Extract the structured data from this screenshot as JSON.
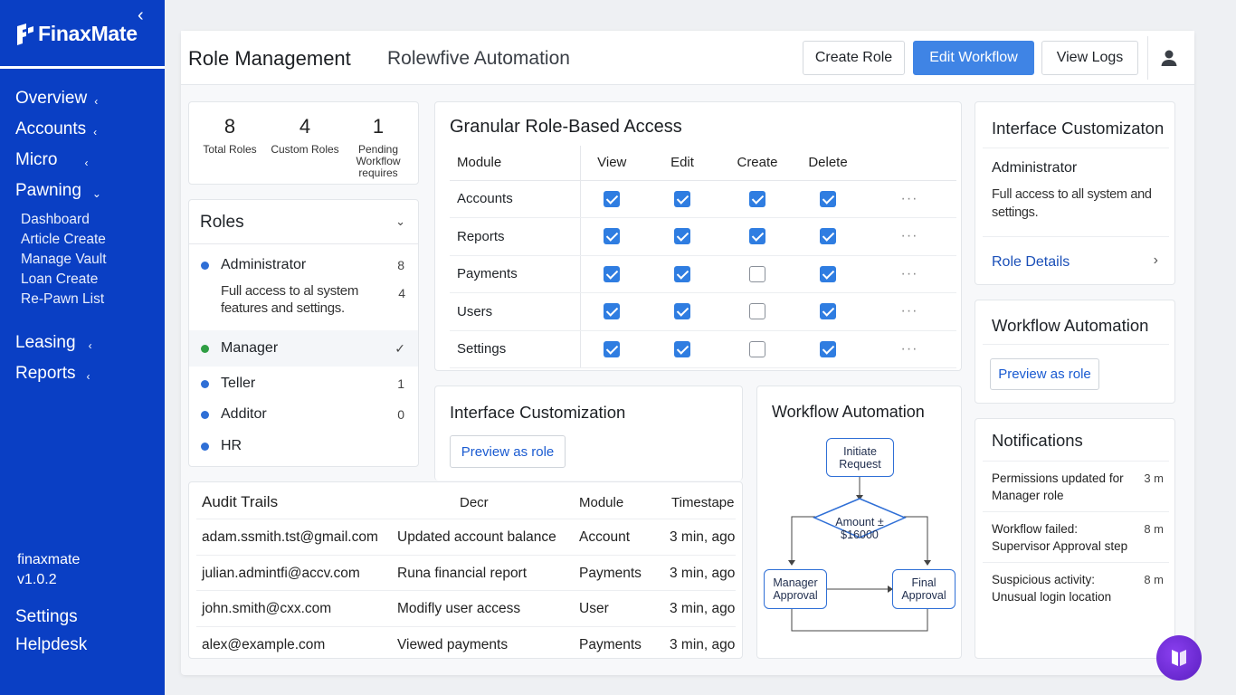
{
  "sidebar": {
    "logo": "FinaxMate",
    "nav": [
      {
        "label": "Overview"
      },
      {
        "label": "Accounts"
      },
      {
        "label": "Micro"
      },
      {
        "label": "Pawning"
      },
      {
        "label": "Leasing"
      },
      {
        "label": "Reports"
      }
    ],
    "pawning_sub": [
      "Dashboard",
      "Article Create",
      "Manage Vault",
      "Loan Create",
      "Re-Pawn List"
    ],
    "app_name": "finaxmate",
    "version": "v1.0.2",
    "settings": "Settings",
    "helpdesk": "Helpdesk"
  },
  "header": {
    "title": "Role Management",
    "subtitle": "Rolewfive Automation",
    "create_role": "Create Role",
    "edit_workflow": "Edit Workflow",
    "view_logs": "View Logs"
  },
  "stats": [
    {
      "value": "8",
      "label": "Total Roles"
    },
    {
      "value": "4",
      "label": "Custom Roles"
    },
    {
      "value": "1",
      "label_lines": [
        "Pending",
        "Workflow",
        "requires"
      ]
    }
  ],
  "roles": {
    "title": "Roles",
    "items": [
      {
        "name": "Administrator",
        "count": "8",
        "color": "#2f6fd6"
      },
      {
        "name": "Manager",
        "color": "#2f9e44"
      },
      {
        "name": "Teller",
        "count": "1",
        "color": "#2f6fd6"
      },
      {
        "name": "Additor",
        "count": "0",
        "color": "#2f6fd6"
      },
      {
        "name": "HR",
        "color": "#2f6fd6"
      }
    ],
    "admin_desc": "Full access to al system features and settings.",
    "admin_desc_count": "4"
  },
  "access": {
    "title": "Granular Role-Based Access",
    "columns": [
      "Module",
      "View",
      "Edit",
      "Create",
      "Delete"
    ],
    "rows": [
      {
        "module": "Accounts",
        "perms": [
          true,
          true,
          true,
          true
        ]
      },
      {
        "module": "Reports",
        "perms": [
          true,
          true,
          true,
          true
        ]
      },
      {
        "module": "Payments",
        "perms": [
          true,
          true,
          false,
          true
        ]
      },
      {
        "module": "Users",
        "perms": [
          true,
          true,
          false,
          true
        ]
      },
      {
        "module": "Settings",
        "perms": [
          true,
          true,
          false,
          true
        ]
      }
    ],
    "more": "···"
  },
  "interface": {
    "title": "Interface Customization",
    "preview": "Preview as role"
  },
  "workflow": {
    "title": "Workflow Automation",
    "initiate": "Initiate Request",
    "amount": "Amount ± $16000",
    "manager": "Manager Approval",
    "final": "Final Approval"
  },
  "audit": {
    "title": "Audit Trails",
    "col_desc": "Decr",
    "col_module": "Module",
    "col_time": "Timestape",
    "rows": [
      {
        "user": "adam.ssmith.tst@gmail.com",
        "desc": "Updated account balance",
        "module": "Account",
        "time": "3 min, ago"
      },
      {
        "user": "julian.admintfi@accv.com",
        "desc": "Runa financial report",
        "module": "Payments",
        "time": "3 min, ago"
      },
      {
        "user": "john.smith@cxx.com",
        "desc": "Modifly user access",
        "module": "User",
        "time": "3 min, ago"
      },
      {
        "user": "alex@example.com",
        "desc": "Viewed payments",
        "module": "Payments",
        "time": "3 min, ago"
      }
    ]
  },
  "right": {
    "ic_title": "Interface Customizaton",
    "ic_role": "Administrator",
    "ic_desc": "Full access to all system and settings.",
    "role_details": "Role Details",
    "wa_title": "Workflow Automation",
    "wa_preview": "Preview as role",
    "notif_title": "Notifications",
    "notifications": [
      {
        "text": "Permissions updated for Manager role",
        "time": "3 m"
      },
      {
        "text": "Workflow failed: Supervisor Approval step",
        "time": "8 m"
      },
      {
        "text": "Suspicious activity: Unusual login location",
        "time": "8 m"
      }
    ]
  },
  "colors": {
    "sidebar": "#0a3fc4",
    "primary": "#3f84e5",
    "check": "#2f7de1"
  }
}
